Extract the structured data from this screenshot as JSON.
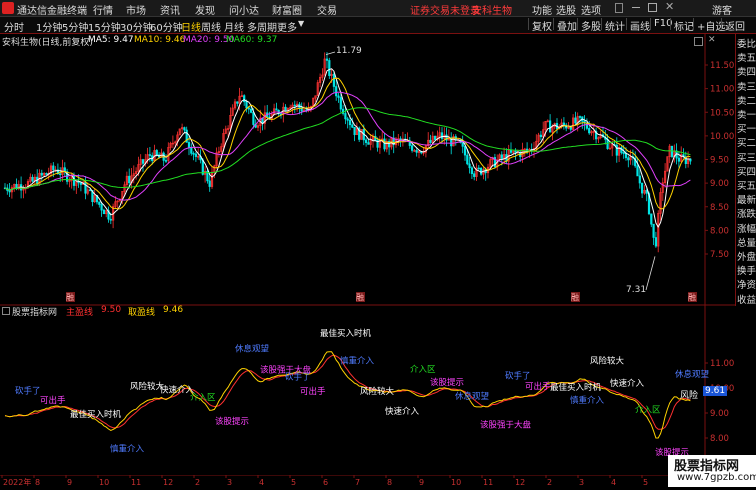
{
  "titlebar": {
    "app_name": "通达信金融终端",
    "menu": [
      "行情",
      "市场",
      "资讯",
      "发现",
      "问小达",
      "财富圈",
      "交易"
    ],
    "notice": "证券交易未登录",
    "stock_short": "安科生物",
    "right_menu": [
      "功能",
      "选股",
      "选项"
    ],
    "user": "游客"
  },
  "toolbar": {
    "periods": [
      "分时",
      "1分钟",
      "5分钟",
      "15分钟",
      "30分钟",
      "60分钟",
      "日线",
      "周线",
      "月线",
      "多周期",
      "更多"
    ],
    "active_period": "日线",
    "right_buttons": [
      "复权",
      "叠加",
      "多股",
      "统计",
      "画线",
      "F10",
      "标记",
      "+自选",
      "返回"
    ]
  },
  "main_chart": {
    "title": "安科生物(日线,前复权)",
    "ma_labels": [
      {
        "text": "MA5: 9.47",
        "color": "#ffffff"
      },
      {
        "text": "MA10: 9.46",
        "color": "#ffd200"
      },
      {
        "text": "MA20: 9.50",
        "color": "#e040fb"
      },
      {
        "text": "MA60: 9.37",
        "color": "#22dd22"
      }
    ],
    "price_ticks": [
      "11.50",
      "11.00",
      "10.50",
      "10.00",
      "9.50",
      "9.00",
      "8.50",
      "8.00",
      "7.50"
    ],
    "high_label": "11.79",
    "low_label": "7.31",
    "bottom_markers": [
      "融",
      "融",
      "融",
      "融"
    ]
  },
  "right_panel": [
    "委比",
    "卖五",
    "卖四",
    "卖三",
    "卖二",
    "卖一",
    "买一",
    "买二",
    "买三",
    "买四",
    "买五",
    "最新",
    "涨跌",
    "涨幅",
    "总量",
    "外盘",
    "换手",
    "净资",
    "收益"
  ],
  "indicator": {
    "title": "股票指标网",
    "line1": {
      "name": "主盈线",
      "value": "9.50",
      "color": "#ff3030"
    },
    "line2": {
      "name": "取盈线",
      "value": "9.46",
      "color": "#ffd200"
    },
    "ticks": [
      "11.00",
      "10.00",
      "9.00",
      "8.00"
    ],
    "right_value": "9.61",
    "right_label": "风险",
    "annotations": [
      {
        "t": "砍手了",
        "c": "#4f7bff"
      },
      {
        "t": "该股提示",
        "c": "#ff44ff"
      },
      {
        "t": "风险较大",
        "c": "#ffffff"
      },
      {
        "t": "可出手",
        "c": "#ff44ff"
      },
      {
        "t": "休息观望",
        "c": "#4f7bff"
      },
      {
        "t": "快速介入",
        "c": "#ffffff"
      },
      {
        "t": "最佳买入时机",
        "c": "#ffffff"
      },
      {
        "t": "该股强于大盘",
        "c": "#ff44ff"
      },
      {
        "t": "介入区",
        "c": "#22dd22"
      },
      {
        "t": "慎重介入",
        "c": "#4f7bff"
      }
    ]
  },
  "bottom_axis": [
    "2022年",
    "8",
    "9",
    "10",
    "11",
    "12",
    "2",
    "3",
    "4",
    "5",
    "6",
    "7",
    "8",
    "9",
    "10",
    "11",
    "12",
    "2",
    "3",
    "4",
    "5"
  ],
  "watermark": {
    "cn": "股票指标网",
    "url": "www.7gpzb.com"
  }
}
